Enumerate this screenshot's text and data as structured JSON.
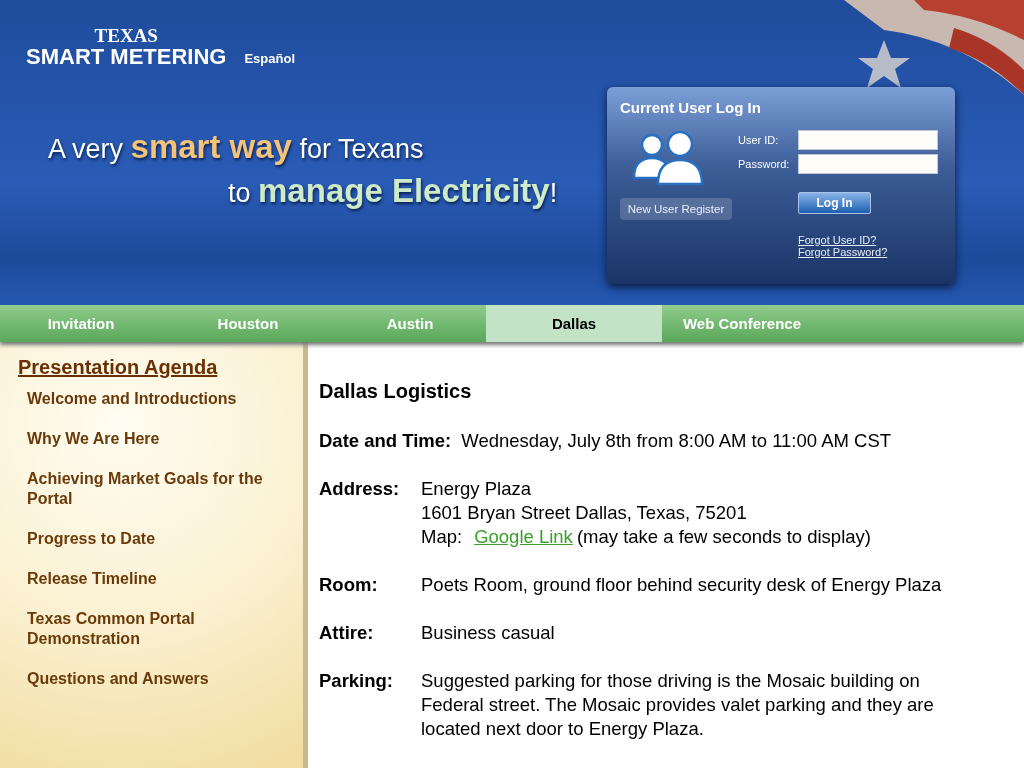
{
  "header": {
    "logo_top": "TEXAS",
    "logo_main": "SMART METERING",
    "language_link": "Español",
    "headline_1": "A very **smart way** for Texans",
    "headline_2": "to **manage Electricity**!"
  },
  "login": {
    "title": "Current User Log In",
    "user_label": "User ID:",
    "password_label": "Password:",
    "login_button": "Log In",
    "register_button": "New User Register",
    "links": [
      "Forgot User ID?",
      "Forgot Password?"
    ]
  },
  "tabs": [
    {
      "label": "Invitation",
      "selected": false
    },
    {
      "label": "Houston",
      "selected": false
    },
    {
      "label": "Austin",
      "selected": false
    },
    {
      "label": "Dallas",
      "selected": true
    },
    {
      "label": "Web Conference",
      "selected": false
    }
  ],
  "sidebar": {
    "title": "Presentation Agenda",
    "items": [
      "Welcome and Introductions",
      "Why We Are Here",
      "Achieving Market Goals for the Portal",
      "Progress to Date",
      "Release Timeline",
      "Texas Common Portal Demonstration",
      "Questions and Answers"
    ]
  },
  "content": {
    "title": "Dallas Logistics",
    "rows": [
      {
        "label": "Date and Time:",
        "kind": "inline",
        "lines": [
          {
            "kind": "text",
            "text": "Wednesday, July 8th from 8:00 AM to 11:00 AM CST"
          }
        ]
      },
      {
        "label": "Address:",
        "kind": "column",
        "lines": [
          {
            "kind": "text",
            "text": "Energy Plaza"
          },
          {
            "kind": "text",
            "text": "1601 Bryan Street Dallas, Texas, 75201"
          },
          {
            "kind": "link",
            "prefix": "Map:",
            "link": "Google Link",
            "suffix": "(may take a few seconds to display)"
          }
        ]
      },
      {
        "label": "Room:",
        "kind": "column",
        "lines": [
          {
            "kind": "text",
            "text": "Poets Room, ground floor behind security desk of Energy Plaza"
          }
        ]
      },
      {
        "label": "Attire:",
        "kind": "column",
        "lines": [
          {
            "kind": "text",
            "text": "Business casual"
          }
        ]
      },
      {
        "label": "Parking:",
        "kind": "column",
        "lines": [
          {
            "kind": "text",
            "text": "Suggested parking for those driving is the Mosaic building on Federal street.  The Mosaic provides valet parking and they are located next door to Energy Plaza."
          }
        ]
      }
    ]
  }
}
